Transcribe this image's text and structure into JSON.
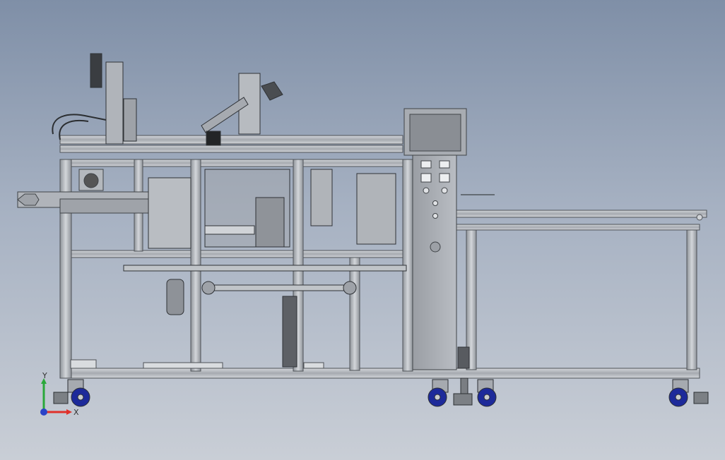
{
  "viewport": {
    "background_top": "#7f8fa7",
    "background_bottom": "#c9ced6",
    "frame_color": "#b9bdc3",
    "frame_edge": "#5a5e63",
    "wheel_color": "#1d2a9a"
  },
  "triad": {
    "x_label": "X",
    "y_label": "Y",
    "x_color": "#e0302a",
    "y_color": "#2aa83a",
    "z_color": "#2a43c8"
  }
}
